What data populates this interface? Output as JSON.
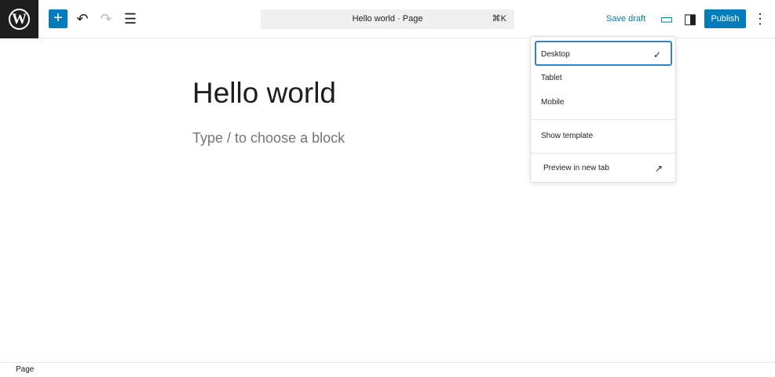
{
  "header": {
    "document_title": "Hello world · Page",
    "shortcut": "⌘K",
    "save_draft": "Save draft",
    "publish": "Publish"
  },
  "editor": {
    "title": "Hello world",
    "placeholder": "Type / to choose a block"
  },
  "preview_menu": {
    "items": [
      {
        "label": "Desktop",
        "selected": true
      },
      {
        "label": "Tablet"
      },
      {
        "label": "Mobile"
      }
    ],
    "show_template": "Show template",
    "preview_new_tab": "Preview in new tab"
  },
  "footer": {
    "breadcrumb": "Page"
  },
  "colors": {
    "accent": "#007cba",
    "logo_bg": "#1e1e1e"
  }
}
